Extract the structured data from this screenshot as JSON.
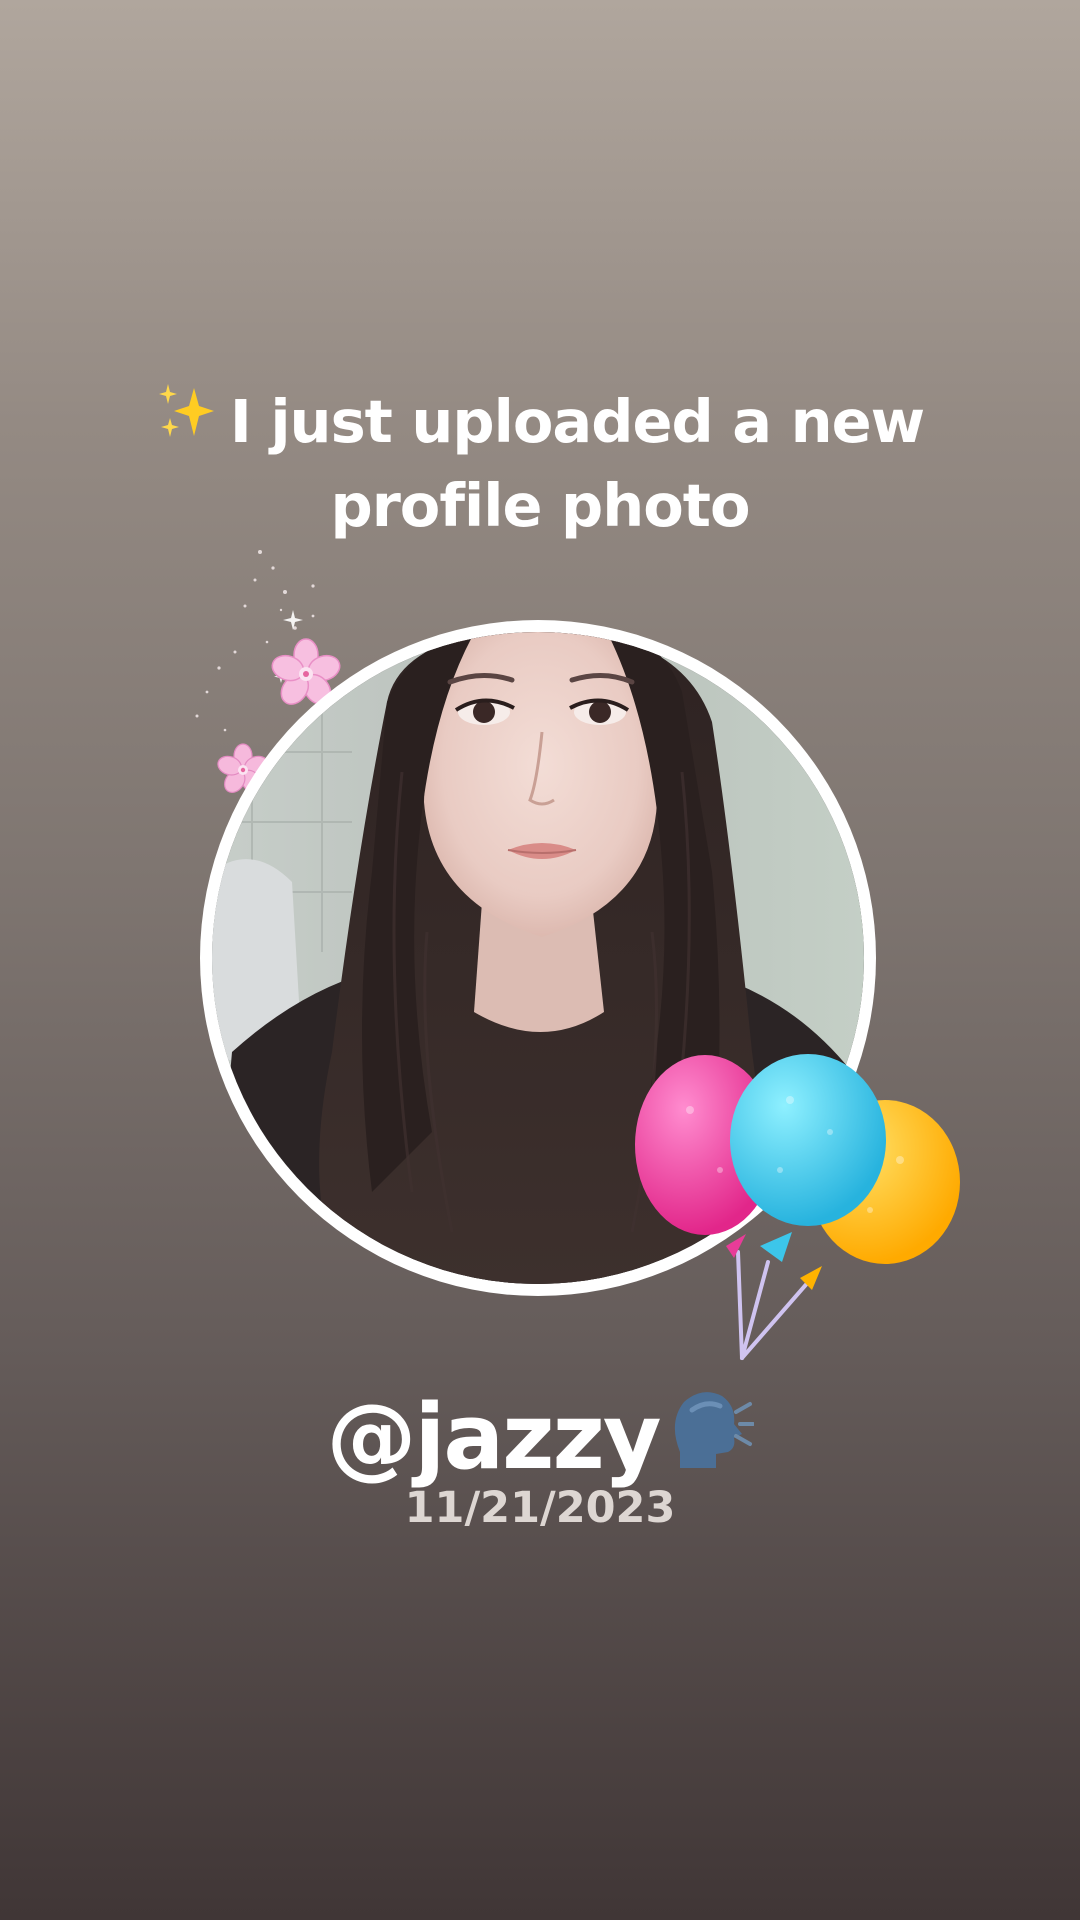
{
  "headline": {
    "line1": "I just uploaded a new",
    "line2": "profile photo",
    "leading_icon": "sparkles-icon"
  },
  "profile": {
    "username": "@jazzy",
    "username_icon": "speaking-head-icon",
    "date": "11/21/2023"
  },
  "decorations": {
    "flowers": "cherry-blossom-icon",
    "balloons": "balloons-icon",
    "balloon_colors": [
      "#f0479c",
      "#42c8e8",
      "#ffc21a"
    ]
  },
  "colors": {
    "text": "#ffffff",
    "date_text": "#ddd6d2",
    "ring": "#ffffff"
  }
}
